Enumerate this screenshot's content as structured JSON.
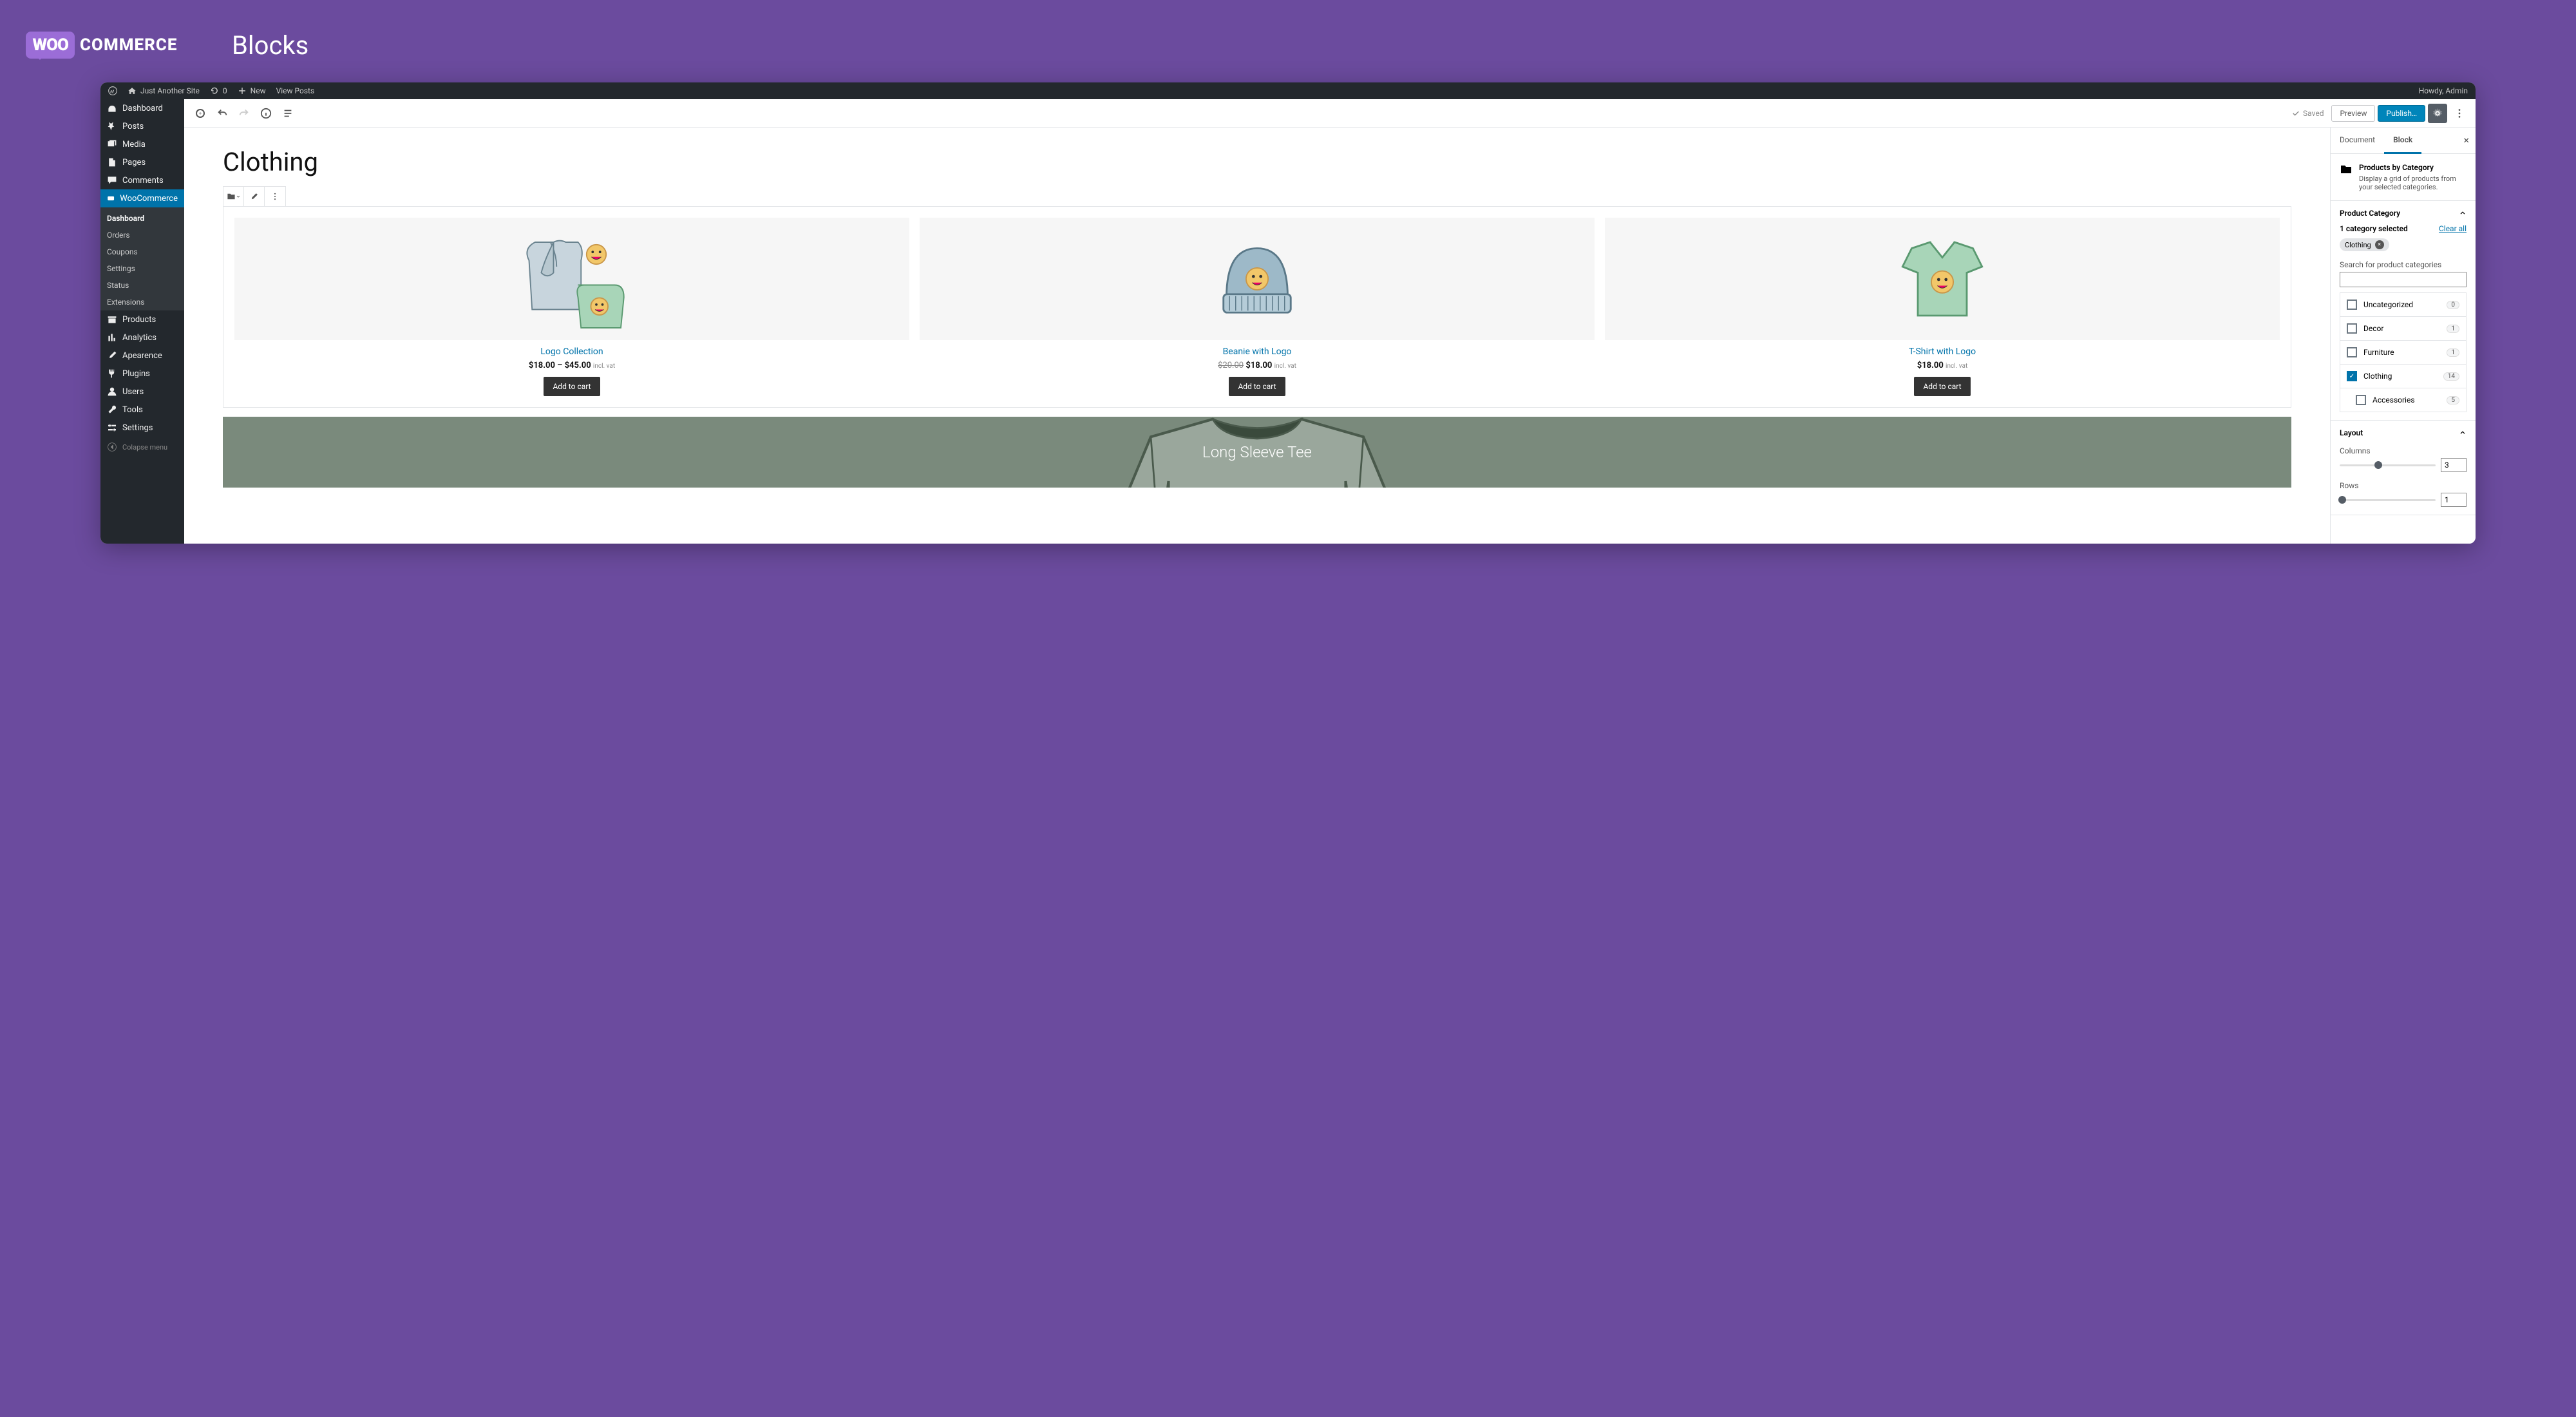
{
  "brand": {
    "bubble": "WOO",
    "text": "COMMERCE",
    "page_area_title": "Blocks"
  },
  "adminbar": {
    "site_name": "Just Another Site",
    "updates": "0",
    "new_label": "New",
    "view_posts": "View Posts",
    "howdy": "Howdy, Admin"
  },
  "sidebar": {
    "items": [
      {
        "icon": "dashboard",
        "label": "Dashboard"
      },
      {
        "icon": "pin",
        "label": "Posts"
      },
      {
        "icon": "media",
        "label": "Media"
      },
      {
        "icon": "page",
        "label": "Pages"
      },
      {
        "icon": "comment",
        "label": "Comments"
      }
    ],
    "woo_label": "WooCommerce",
    "woo_sub": [
      "Dashboard",
      "Orders",
      "Coupons",
      "Settings",
      "Status",
      "Extensions"
    ],
    "items2": [
      {
        "icon": "archive",
        "label": "Products"
      },
      {
        "icon": "chart",
        "label": "Analytics"
      },
      {
        "icon": "brush",
        "label": "Apearence"
      },
      {
        "icon": "plug",
        "label": "Plugins"
      },
      {
        "icon": "user",
        "label": "Users"
      },
      {
        "icon": "wrench",
        "label": "Tools"
      },
      {
        "icon": "sliders",
        "label": "Settings"
      }
    ],
    "collapse": "Colapse menu"
  },
  "toolbar": {
    "saved": "Saved",
    "preview": "Preview",
    "publish": "Publish…"
  },
  "page": {
    "title": "Clothing"
  },
  "products": [
    {
      "title": "Logo Collection",
      "price_html": "$18.00 – $45.00",
      "vat": "incl. vat",
      "cta": "Add to cart"
    },
    {
      "title": "Beanie with Logo",
      "old": "$20.00",
      "price_html": "$18.00",
      "vat": "incl. vat",
      "cta": "Add to cart"
    },
    {
      "title": "T-Shirt with Logo",
      "price_html": "$18.00",
      "vat": "incl. vat",
      "cta": "Add to cart"
    }
  ],
  "cover": {
    "text": "Long Sleeve Tee"
  },
  "inspector": {
    "tabs": {
      "document": "Document",
      "block": "Block"
    },
    "block_title": "Products by Category",
    "block_desc": "Display a grid of products from your selected categories.",
    "section_category": "Product Category",
    "selected_text": "1 category selected",
    "clear_all": "Clear all",
    "chip": "Clothing",
    "search_label": "Search for product categories",
    "categories": [
      {
        "label": "Uncategorized",
        "count": "0",
        "checked": false
      },
      {
        "label": "Decor",
        "count": "1",
        "checked": false
      },
      {
        "label": "Furniture",
        "count": "1",
        "checked": false
      },
      {
        "label": "Clothing",
        "count": "14",
        "checked": true
      },
      {
        "label": "Accessories",
        "count": "5",
        "checked": false,
        "indent": true
      }
    ],
    "section_layout": "Layout",
    "columns_label": "Columns",
    "columns_value": "3",
    "rows_label": "Rows",
    "rows_value": "1"
  }
}
